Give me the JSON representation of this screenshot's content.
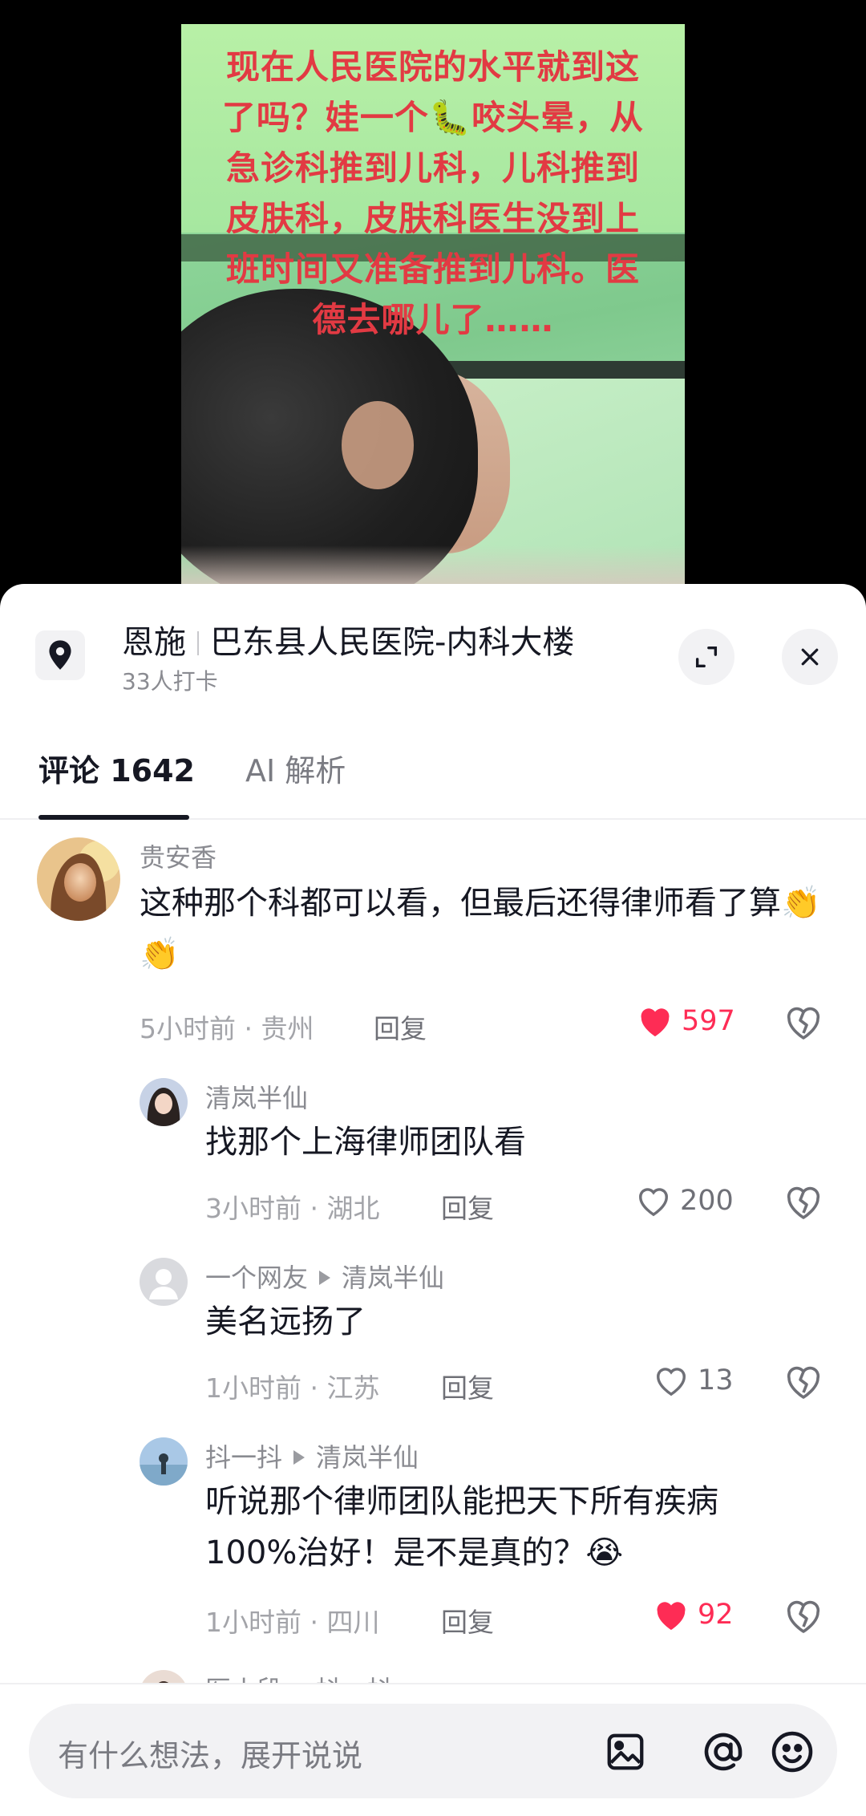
{
  "video": {
    "caption": "现在人民医院的水平就到这了吗？娃一个🐛咬头晕，从急诊科推到儿科，儿科推到皮肤科，皮肤科医生没到上班时间又准备推到儿科。医德去哪儿了……"
  },
  "location": {
    "city": "恩施",
    "place": "巴东县人民医院-内科大楼",
    "checkins": "33人打卡"
  },
  "tabs": {
    "comments_label": "评论 1642",
    "ai_label": "AI 解析"
  },
  "comments": [
    {
      "name": "贵安香",
      "text": "这种那个科都可以看，但最后还得律师看了算👏👏",
      "time": "5小时前",
      "region": "贵州",
      "reply": "回复",
      "likes": "597",
      "liked": true
    },
    {
      "name": "清岚半仙",
      "text": "找那个上海律师团队看",
      "time": "3小时前",
      "region": "湖北",
      "reply": "回复",
      "likes": "200",
      "liked": false
    },
    {
      "name": "一个网友",
      "reply_to": "清岚半仙",
      "text": "美名远扬了",
      "time": "1小时前",
      "region": "江苏",
      "reply": "回复",
      "likes": "13",
      "liked": false
    },
    {
      "name": "抖一抖",
      "reply_to": "清岚半仙",
      "text": "听说那个律师团队能把天下所有疾病100%治好！是不是真的？😭",
      "time": "1小时前",
      "region": "四川",
      "reply": "回复",
      "likes": "92",
      "liked": true
    },
    {
      "name": "医小段",
      "reply_to": "抖一抖"
    }
  ],
  "input": {
    "placeholder": "有什么想法，展开说说"
  },
  "icons": {
    "location": "location-pin-icon",
    "expand": "expand-icon",
    "close": "close-icon",
    "like": "heart-icon",
    "dislike": "broken-heart-icon",
    "image": "image-icon",
    "mention": "at-icon",
    "emoji": "emoji-icon"
  },
  "colors": {
    "accent_like": "#fe2c55",
    "caption_red": "#e23a43"
  }
}
